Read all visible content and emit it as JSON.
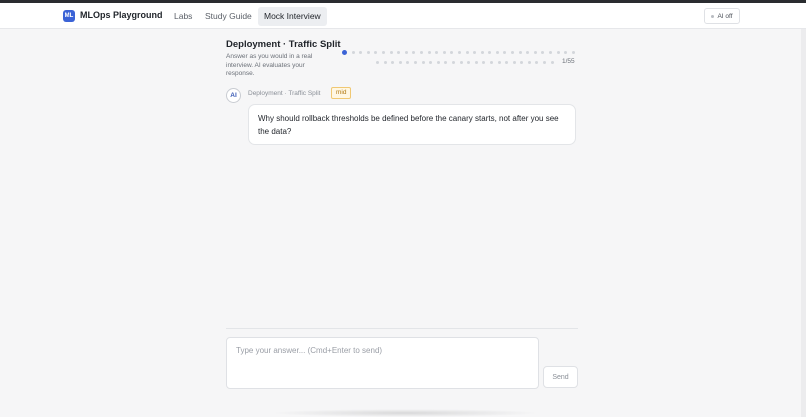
{
  "app": {
    "logo_text": "ML",
    "name": "MLOps Playground"
  },
  "nav": {
    "items": [
      {
        "label": "Labs"
      },
      {
        "label": "Study Guide"
      },
      {
        "label": "Mock Interview",
        "active": true
      }
    ]
  },
  "ai_toggle": {
    "label": "AI off"
  },
  "interview": {
    "title": "Deployment · Traffic Split",
    "subtitle": "Answer as you would in a real interview. AI evaluates your response.",
    "progress": {
      "current": 1,
      "total": 55,
      "label": "1/55"
    }
  },
  "message": {
    "avatar_label": "AI",
    "topic": "Deployment · Traffic Split",
    "level": "mid",
    "text": "Why should rollback thresholds be defined before the canary starts, not after you see the data?"
  },
  "composer": {
    "placeholder": "Type your answer... (Cmd+Enter to send)",
    "value": "",
    "send_label": "Send"
  },
  "colors": {
    "accent": "#3b63d6",
    "badge_bg": "#fff7e3",
    "badge_text": "#b07710"
  }
}
